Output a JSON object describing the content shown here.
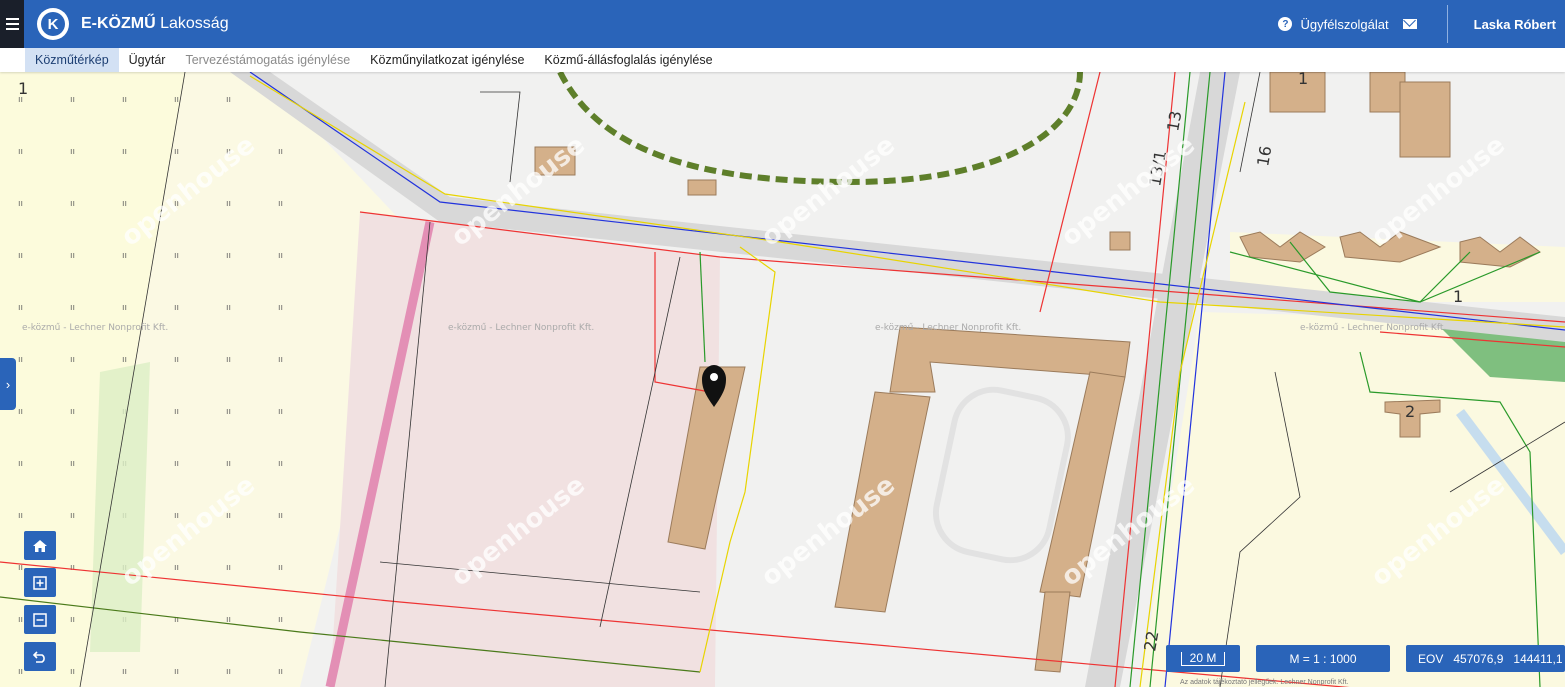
{
  "header": {
    "brand_bold": "E-KÖZMŰ",
    "brand_light": "Lakosság",
    "logo_letter": "K",
    "support_label": "Ügyfélszolgálat",
    "user_name": "Laska Róbert",
    "bg_color": "#2a64b9"
  },
  "nav": {
    "items": [
      {
        "label": "Közműtérkép",
        "active": true
      },
      {
        "label": "Ügytár"
      },
      {
        "label": "Tervezéstámogatás igénylése",
        "disabled": true
      },
      {
        "label": "Közműnyilatkozat igénylése"
      },
      {
        "label": "Közmű-állásfoglalás igénylése"
      }
    ]
  },
  "map": {
    "watermark": "openhouse",
    "faint_label": "e-közmű - Lechner Nonprofit Kft.",
    "parcel_numbers": [
      "1",
      "13",
      "13/1",
      "16",
      "1",
      "2",
      "22",
      "1"
    ]
  },
  "controls": {
    "side_toggle": "›"
  },
  "status": {
    "scale_bar": "20 M",
    "scale_ratio": "M = 1 : 1000",
    "eov_label": "EOV",
    "eov_x": "457076,9",
    "eov_y": "144411,1"
  },
  "attribution": "Az adatok tájékoztató jellegűek. Lechner Nonprofit Kft."
}
